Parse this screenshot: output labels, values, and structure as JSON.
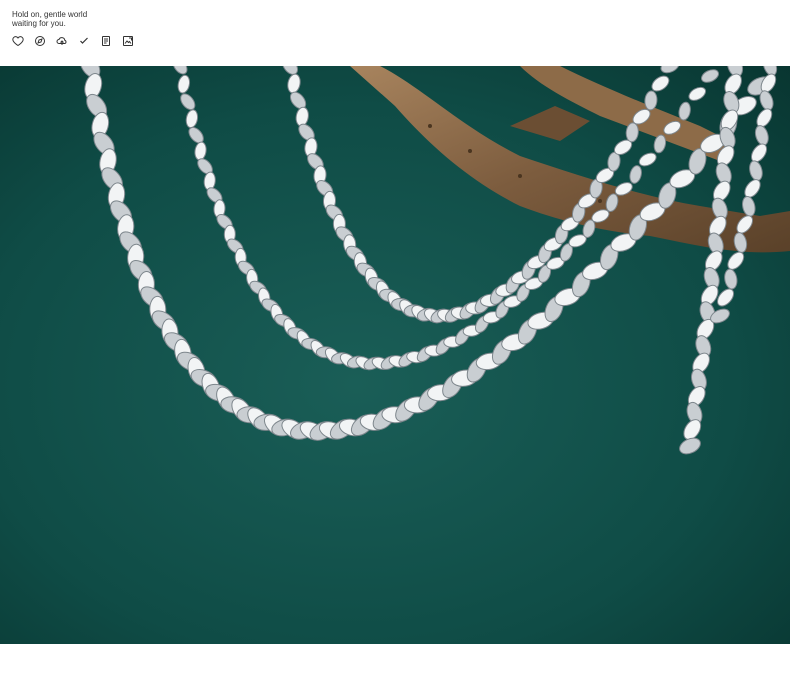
{
  "header": {
    "line1": "Hold on, gentle world",
    "line2": "waiting for you."
  },
  "toolbar": {
    "icons": [
      "heart-icon",
      "compass-icon",
      "cloud-share-icon",
      "check-icon",
      "document-icon",
      "image-edit-icon"
    ]
  },
  "photo": {
    "subject": "silver chain necklaces on driftwood",
    "colors": {
      "background": "#0d4a45",
      "chain": "#d9dde0",
      "wood": "#8a6a4a"
    }
  }
}
